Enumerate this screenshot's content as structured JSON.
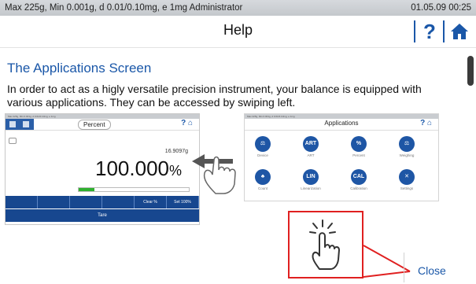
{
  "status_bar": {
    "left_text": "Max 225g, Min 0.001g, d 0.01/0.10mg, e 1mg  Administrator",
    "datetime": "01.05.09 00:25"
  },
  "header": {
    "title": "Help",
    "help_glyph": "?",
    "home_icon": "home-icon"
  },
  "article": {
    "heading": "The Applications Screen",
    "body": "In order to act as a higly versatile precision instrument, your balance is equipped with various applications. They can be accessed by swiping left."
  },
  "illustration_percent": {
    "status_text": "Max 225g, Min 0.001g, d 0.01/0.10mg, e 1mg",
    "pill_label": "Percent",
    "small_value": "16.9097g",
    "big_value": "100.000",
    "big_unit": "%",
    "progress_fraction": 0.14,
    "buttons": [
      "",
      "",
      "",
      "",
      "Clear %",
      "Set 100%"
    ],
    "tare_label": "Tare"
  },
  "illustration_apps": {
    "status_text": "Max 225g, Min 0.001g, d 0.01/0.10mg, e 1mg",
    "title": "Applications",
    "apps": [
      {
        "glyph": "⚖",
        "label": "Device"
      },
      {
        "glyph": "ART",
        "label": "ART"
      },
      {
        "glyph": "%",
        "label": "Percent"
      },
      {
        "glyph": "⚖",
        "label": "Weighing"
      },
      {
        "glyph": "♣",
        "label": "Count"
      },
      {
        "glyph": "LIN",
        "label": "Linearization"
      },
      {
        "glyph": "CAL",
        "label": "Calibration"
      },
      {
        "glyph": "✕",
        "label": "Settings"
      }
    ]
  },
  "footer": {
    "close_label": "Close"
  },
  "colors": {
    "accent": "#1a57a8",
    "callout": "#e02020",
    "progress": "#2fb02f"
  }
}
